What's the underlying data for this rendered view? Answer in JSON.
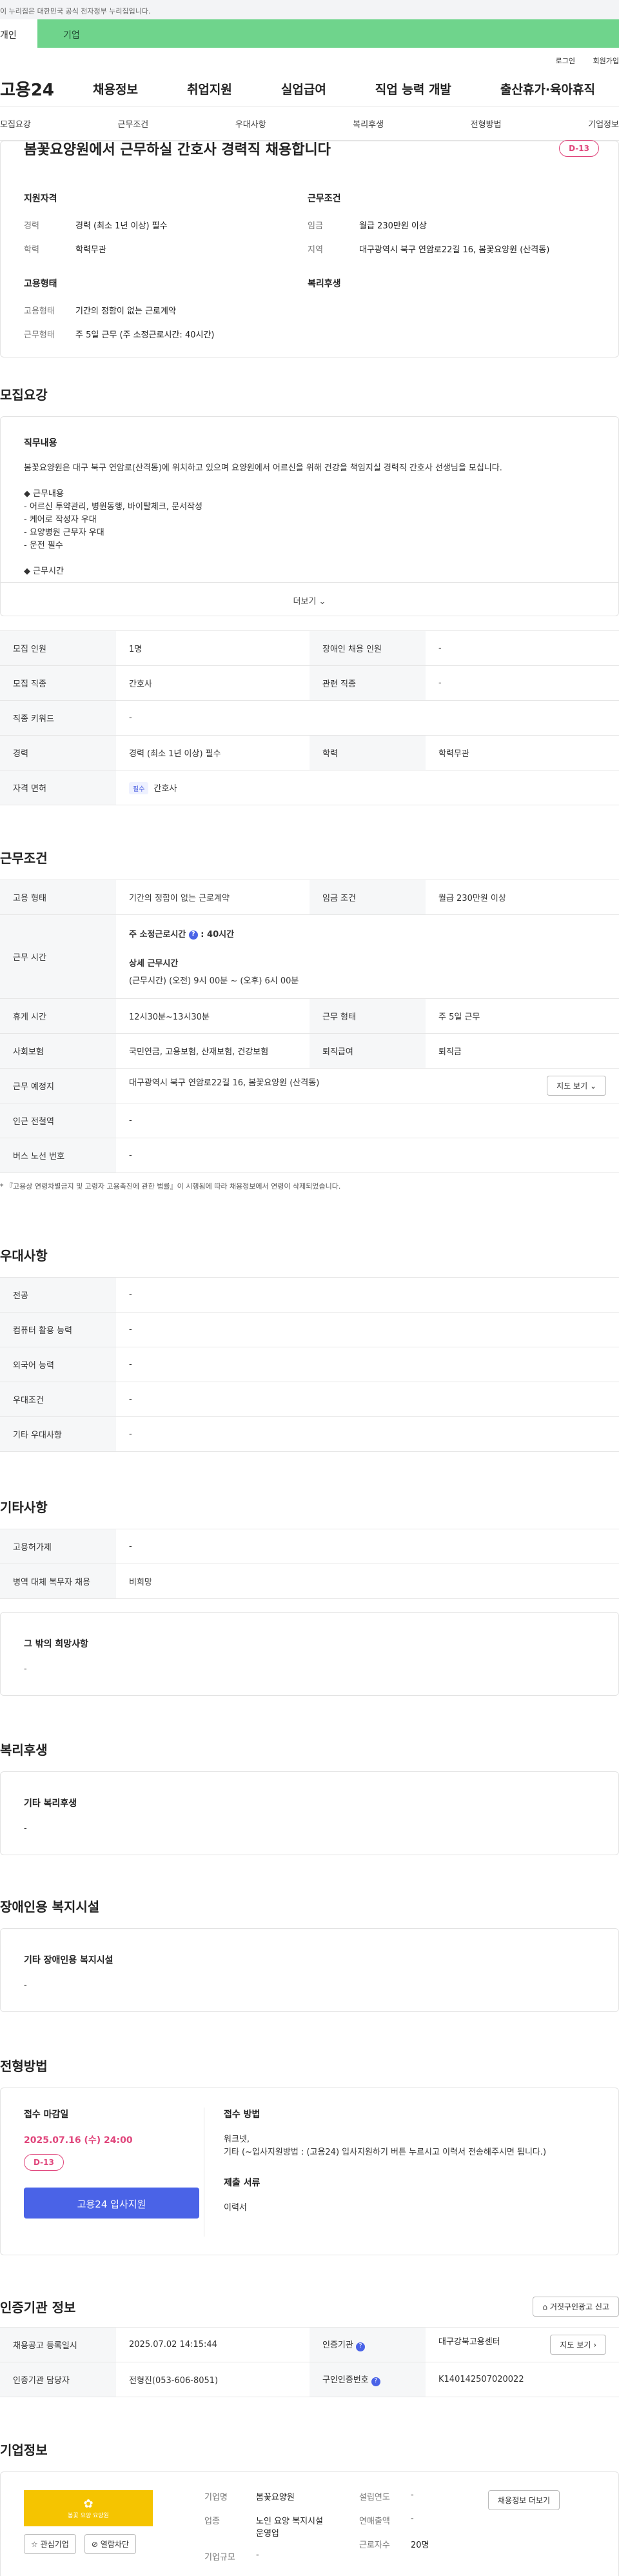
{
  "gov_banner": "이 누리집은 대한민국 공식 전자정부 누리집입니다.",
  "top_tabs": {
    "personal": "개인",
    "company": "기업"
  },
  "util": {
    "login": "로그인",
    "join": "회원가입"
  },
  "gnb": {
    "logo": "고용24",
    "items": [
      "채용정보",
      "취업지원",
      "실업급여",
      "직업 능력 개발",
      "출산휴가·육아휴직"
    ]
  },
  "secnav": [
    "모집요강",
    "근무조건",
    "우대사항",
    "복리후생",
    "전형방법",
    "기업정보"
  ],
  "header": {
    "title": "봄꽃요양원에서 근무하실 간호사 경력직 채용합니다",
    "dday": "D-13",
    "qual_title": "지원자격",
    "cond_title": "근무조건",
    "career_k": "경력",
    "career_v": "경력 (최소 1년 이상) 필수",
    "edu_k": "학력",
    "edu_v": "학력무관",
    "wage_k": "임금",
    "wage_v": "월급 230만원 이상",
    "area_k": "지역",
    "area_v": "대구광역시 북구 연암로22길 16, 봄꽃요양원 (산격동)",
    "emp_title": "고용형태",
    "welfare_title": "복리후생",
    "etype_k": "고용형태",
    "etype_v": "기간의 정함이 없는 근로계약",
    "wtype_k": "근무형태",
    "wtype_v": "주 5일 근무 (주 소정근로시간: 40시간)"
  },
  "recruit": {
    "title": "모집요강",
    "job_title": "직무내용",
    "lines": [
      "봄꽃요양원은 대구 북구 연암로(산격동)에 위치하고 있으며 요양원에서 어르신을 위해 건강을 책임지실 경력직 간호사 선생님을 모십니다.",
      "",
      "◆ 근무내용",
      "- 어르신 투약관리, 병원동행, 바이탈체크, 문서작성",
      "- 케어로 작성자 우대",
      "- 요양병원 근무자 우대",
      "- 운전 필수",
      "",
      "◆ 근무시간"
    ],
    "more": "더보기",
    "rows": [
      [
        "모집 인원",
        "1명",
        "장애인 채용 인원",
        "-"
      ],
      [
        "모집 직종",
        "간호사",
        "관련 직종",
        "-"
      ],
      [
        "직종 키워드",
        "-",
        "",
        ""
      ],
      [
        "경력",
        "경력 (최소 1년 이상) 필수",
        "학력",
        "학력무관"
      ]
    ],
    "license_k": "자격 면허",
    "license_tag": "필수",
    "license_v": "간호사"
  },
  "work": {
    "title": "근무조건",
    "etype_k": "고용 형태",
    "etype_v": "기간의 정함이 없는 근로계약",
    "wage_k": "임금 조건",
    "wage_v": "월급 230만원 이상",
    "hours_k": "근무 시간",
    "hours_l1": "주 소정근로시간",
    "hours_l1v": "40시간",
    "hours_l2": "상세 근무시간",
    "hours_l3": "(근무시간) (오전) 9시 00분 ~ (오후) 6시 00분",
    "rest_k": "휴게 시간",
    "rest_v": "12시30분~13시30분",
    "form_k": "근무 형태",
    "form_v": "주 5일 근무",
    "ins_k": "사회보험",
    "ins_v": "국민연금, 고용보험, 산재보험, 건강보험",
    "ret_k": "퇴직급여",
    "ret_v": "퇴직금",
    "place_k": "근무 예정지",
    "place_v": "대구광역시 북구 연암로22길 16, 봄꽃요양원 (산격동)",
    "map_btn": "지도 보기",
    "station_k": "인근 전철역",
    "station_v": "-",
    "bus_k": "버스 노선 번호",
    "bus_v": "-",
    "note": "* 『고용상 연령차별금지 및 고령자 고용촉진에 관한 법률』이 시행됨에 따라 채용정보에서 연령이 삭제되었습니다."
  },
  "pref": {
    "title": "우대사항",
    "rows": [
      [
        "전공",
        "-"
      ],
      [
        "컴퓨터 활용 능력",
        "-"
      ],
      [
        "외국어 능력",
        "-"
      ],
      [
        "우대조건",
        "-"
      ],
      [
        "기타 우대사항",
        "-"
      ]
    ]
  },
  "etc": {
    "title": "기타사항",
    "rows": [
      [
        "고용허가제",
        "-"
      ],
      [
        "병역 대체 복무자 채용",
        "비희망"
      ]
    ],
    "other_title": "그 밖의 희망사항",
    "other_v": "-"
  },
  "welfare": {
    "title": "복리후생",
    "sub": "기타 복리후생",
    "v": "-"
  },
  "disab": {
    "title": "장애인용 복지시설",
    "sub": "기타 장애인용 복지시설",
    "v": "-"
  },
  "process": {
    "title": "전형방법",
    "deadline_k": "접수 마감일",
    "deadline_v": "2025.07.16 (수) 24:00",
    "dday": "D-13",
    "apply_btn": "고용24 입사지원",
    "method_k": "접수 방법",
    "method_v1": "워크넷,",
    "method_v2": "기타 (~입사지원방법 : (고용24) 입사지원하기 버튼 누르시고 이력서 전송해주시면 됩니다.)",
    "docs_k": "제출 서류",
    "docs_v": "이력서"
  },
  "cert": {
    "title": "인증기관 정보",
    "report_btn": "거짓구인광고 신고",
    "reg_k": "채용공고 등록일시",
    "reg_v": "2025.07.02 14:15:44",
    "org_k": "인증기관",
    "org_v": "대구강북고용센터",
    "map_btn": "지도 보기",
    "mgr_k": "인증기관 담당자",
    "mgr_v": "전형진(053-606-8051)",
    "num_k": "구인인증번호",
    "num_v": "K140142507020022"
  },
  "company": {
    "title": "기업정보",
    "logo_text": "봄꽃 요양 요양원",
    "fav_btn": "관심기업",
    "block_btn": "열람차단",
    "name_k": "기업명",
    "name_v": "봄꽃요양원",
    "ind_k": "업종",
    "ind_v": "노인 요양 복지시설 운영업",
    "founded_k": "설립연도",
    "founded_v": "-",
    "sales_k": "연매출액",
    "sales_v": "-",
    "emp_k": "근로자수",
    "emp_v": "20명",
    "size_k": "기업규모",
    "size_v": "-",
    "detail_btn": "채용정보 더보기"
  },
  "colors": {
    "green": "#6fd48c",
    "pink": "#e0457b",
    "blue": "#4a63e7",
    "logo": "#f5c400"
  }
}
